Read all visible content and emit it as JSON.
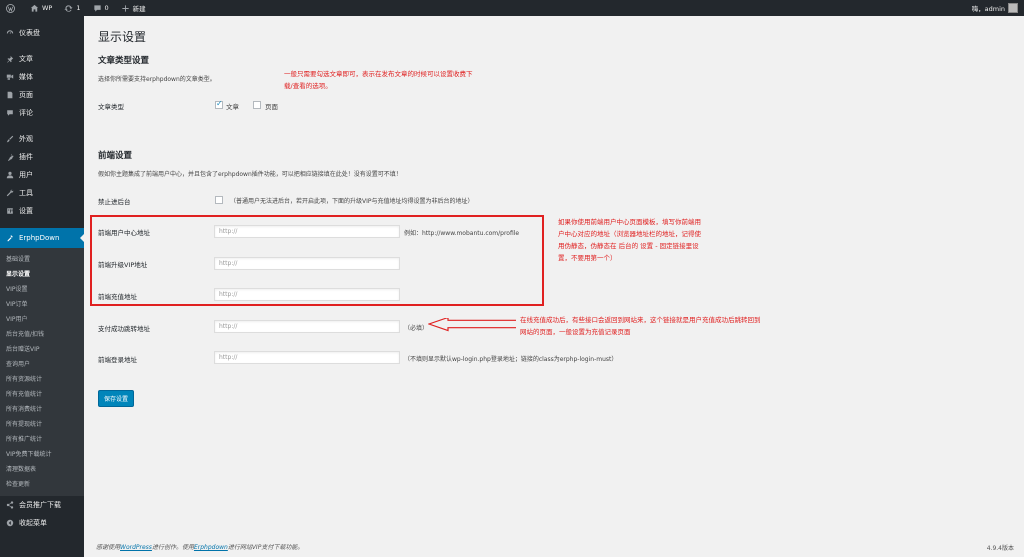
{
  "adminbar": {
    "site": "WP",
    "updates": "1",
    "comments": "0",
    "new_label": "新建",
    "greeting": "嗨，admin"
  },
  "sidebar": {
    "items": [
      {
        "label": "仪表盘",
        "icon": "dashboard-icon"
      },
      {
        "label": "文章",
        "icon": "pin-icon"
      },
      {
        "label": "媒体",
        "icon": "media-icon"
      },
      {
        "label": "页面",
        "icon": "page-icon"
      },
      {
        "label": "评论",
        "icon": "comment-icon"
      },
      {
        "label": "外观",
        "icon": "brush-icon"
      },
      {
        "label": "插件",
        "icon": "plugin-icon"
      },
      {
        "label": "用户",
        "icon": "user-icon"
      },
      {
        "label": "工具",
        "icon": "wrench-icon"
      },
      {
        "label": "设置",
        "icon": "settings-icon"
      }
    ],
    "current": {
      "label": "ErphpDown",
      "icon": "erphpdown-icon"
    },
    "submenu": [
      "基础设置",
      "显示设置",
      "VIP设置",
      "VIP订单",
      "VIP用户",
      "后台充值/扣钱",
      "后台赠送VIP",
      "查询用户",
      "所有资源统计",
      "所有充值统计",
      "所有消费统计",
      "所有提现统计",
      "所有推广统计",
      "VIP免费下载统计",
      "清理数据表",
      "检查更新"
    ],
    "bottom": [
      {
        "label": "会员推广下载",
        "icon": "share-icon"
      },
      {
        "label": "收起菜单",
        "icon": "collapse-icon"
      }
    ]
  },
  "page": {
    "title": "显示设置",
    "section1": {
      "title": "文章类型设置",
      "desc": "选择你所需要支持erphpdown的文章类型。",
      "row_label": "文章类型",
      "opt_post": "文章",
      "opt_page": "页面",
      "note": "一般只需要勾选文章即可，表示在发布文章的时候可以设置收费下载/查看的选项。"
    },
    "section2": {
      "title": "前端设置",
      "desc": "假如你主题集成了前端用户中心，并且包含了erphpdown插件功能，可以把相应链接填在此处！没有设置可不填！",
      "rows": [
        {
          "label": "禁止进后台",
          "after": "（普通用户无法进后台，若开启此项，下面的升级VIP与充值地址均得设置为非后台的地址）"
        },
        {
          "label": "前端用户中心地址",
          "placeholder": "http://",
          "after": "例如：http://www.mobantu.com/profile"
        },
        {
          "label": "前端升级VIP地址",
          "placeholder": "http://",
          "after": ""
        },
        {
          "label": "前端充值地址",
          "placeholder": "http://",
          "after": ""
        },
        {
          "label": "支付成功跳转地址",
          "placeholder": "http://",
          "after": "（必填）"
        },
        {
          "label": "前端登录地址",
          "placeholder": "http://",
          "after": "（不填则显示默认wp-login.php登录地址；链接的class为erphp-login-must）"
        }
      ],
      "note_box": "如果你使用前端用户中心页面模板，填写你前端用户中心对应的地址（浏览器地址栏的地址，记得使用伪静态，伪静态在 后台的 设置 - 固定链接里设置，不要用第一个）",
      "note_arrow": "在线充值成功后，有些接口会返回到网站来，这个链接就是用户充值成功后跳转回到网站的页面，一般设置为充值记录页面"
    },
    "save_button": "保存设置"
  },
  "footer": {
    "pre": "感谢使用",
    "wp": "WordPress",
    "mid": "进行创作。使用",
    "erphp": "Erphpdown",
    "post": "进行网站VIP支付下载功能。",
    "version": "4.9.4版本"
  },
  "colors": {
    "accent": "#0073aa",
    "note": "#e02020",
    "sidebar": "#23282d"
  }
}
